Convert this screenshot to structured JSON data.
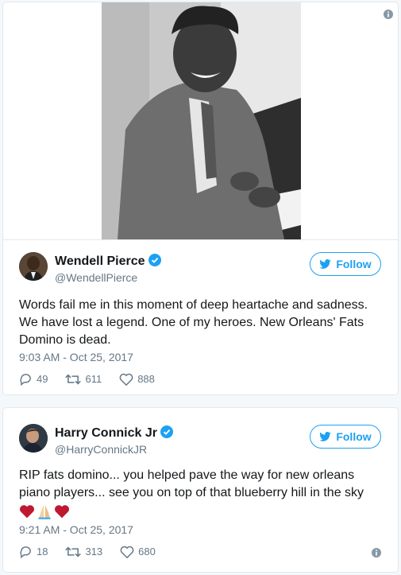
{
  "tweets": [
    {
      "name": "Wendell Pierce",
      "handle": "@WendellPierce",
      "follow_label": "Follow",
      "text": "Words fail me in this moment of deep heartache and sadness. We have lost a legend. One of my heroes. New Orleans' Fats Domino is dead.",
      "time": "9:03 AM - Oct 25, 2017",
      "replies": "49",
      "retweets": "611",
      "likes": "888"
    },
    {
      "name": "Harry Connick Jr",
      "handle": "@HarryConnickJR",
      "follow_label": "Follow",
      "text": "RIP fats domino... you helped pave the way for new orleans piano players... see you on top of that blueberry hill in the sky",
      "emoji": [
        "heart-emoji",
        "folded-hands-emoji",
        "heart-emoji"
      ],
      "time": "9:21 AM - Oct 25, 2017",
      "replies": "18",
      "retweets": "313",
      "likes": "680"
    }
  ],
  "colors": {
    "brand": "#1da1f2",
    "text": "#14171a",
    "muted": "#657786",
    "heart": "#be1931"
  },
  "icons": [
    "info-icon",
    "verified-badge-icon",
    "twitter-bird-icon",
    "reply-icon",
    "retweet-icon",
    "like-icon"
  ]
}
